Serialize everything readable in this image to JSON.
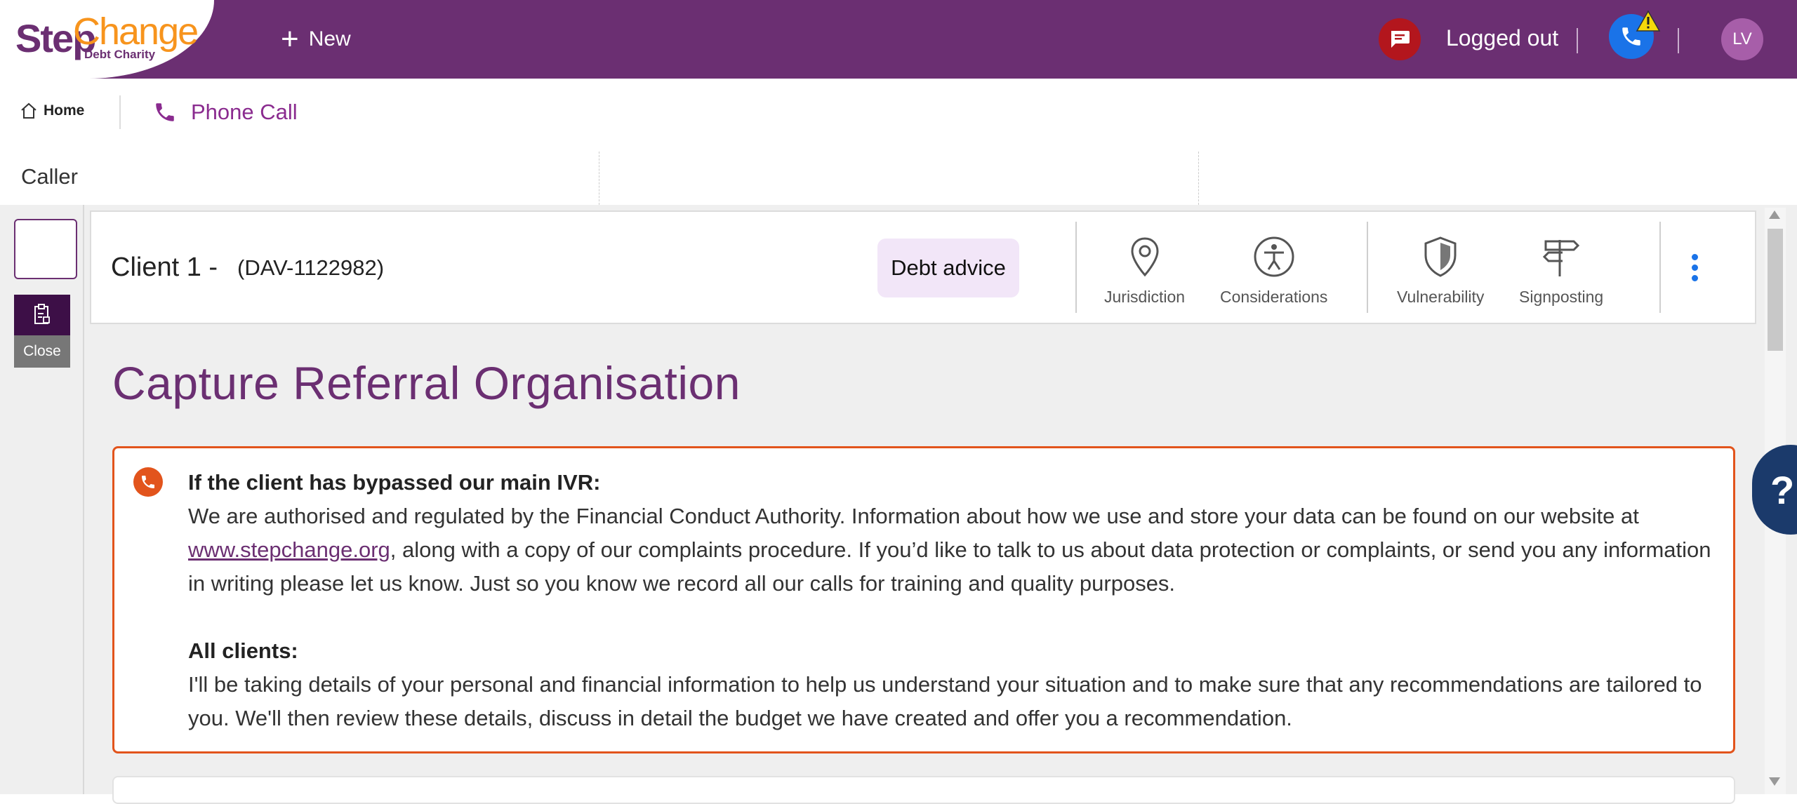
{
  "header": {
    "logo": {
      "part1": "Step",
      "part2": "Change",
      "sub": "Debt Charity"
    },
    "new_label": "New",
    "status_text": "Logged out",
    "avatar_initials": "LV",
    "icons": [
      "chat-icon",
      "phone-icon",
      "warning-icon",
      "plus-icon"
    ],
    "colors": {
      "header_bg": "#6b2f72",
      "chat_bg": "#b3161d",
      "phone_bg": "#1a73e8",
      "warning": "#f5d90a"
    }
  },
  "tabs": {
    "home_label": "Home",
    "phone_call_label": "Phone Call"
  },
  "caller_row": {
    "caller_label": "Caller"
  },
  "rail": {
    "close_label": "Close"
  },
  "client_header": {
    "name": "Client 1  -",
    "id": "(DAV-1122982)",
    "badge": "Debt advice",
    "tools": {
      "jurisdiction": "Jurisdiction",
      "considerations": "Considerations",
      "vulnerability": "Vulnerability",
      "signposting": "Signposting"
    }
  },
  "main": {
    "title": "Capture Referral Organisation",
    "notice": {
      "heading1": "If the client has bypassed our main IVR:",
      "p1_before": "We are authorised and regulated by the Financial Conduct Authority. Information about how we use and store your data can be found on our website at ",
      "p1_link": "www.stepchange.org",
      "p1_after": ", along with a copy of our complaints procedure. If you’d like to talk to us about data protection or complaints, or send you any information in writing please let us know. Just so you know we record all our calls for training and quality purposes.",
      "heading2": "All clients:",
      "p2": "I'll be taking details of your personal and financial information to help us understand your situation and to make sure that any recommendations are tailored to you. We'll then review these details, discuss in detail the budget we have created and offer you a recommendation."
    }
  },
  "help_label": "?"
}
